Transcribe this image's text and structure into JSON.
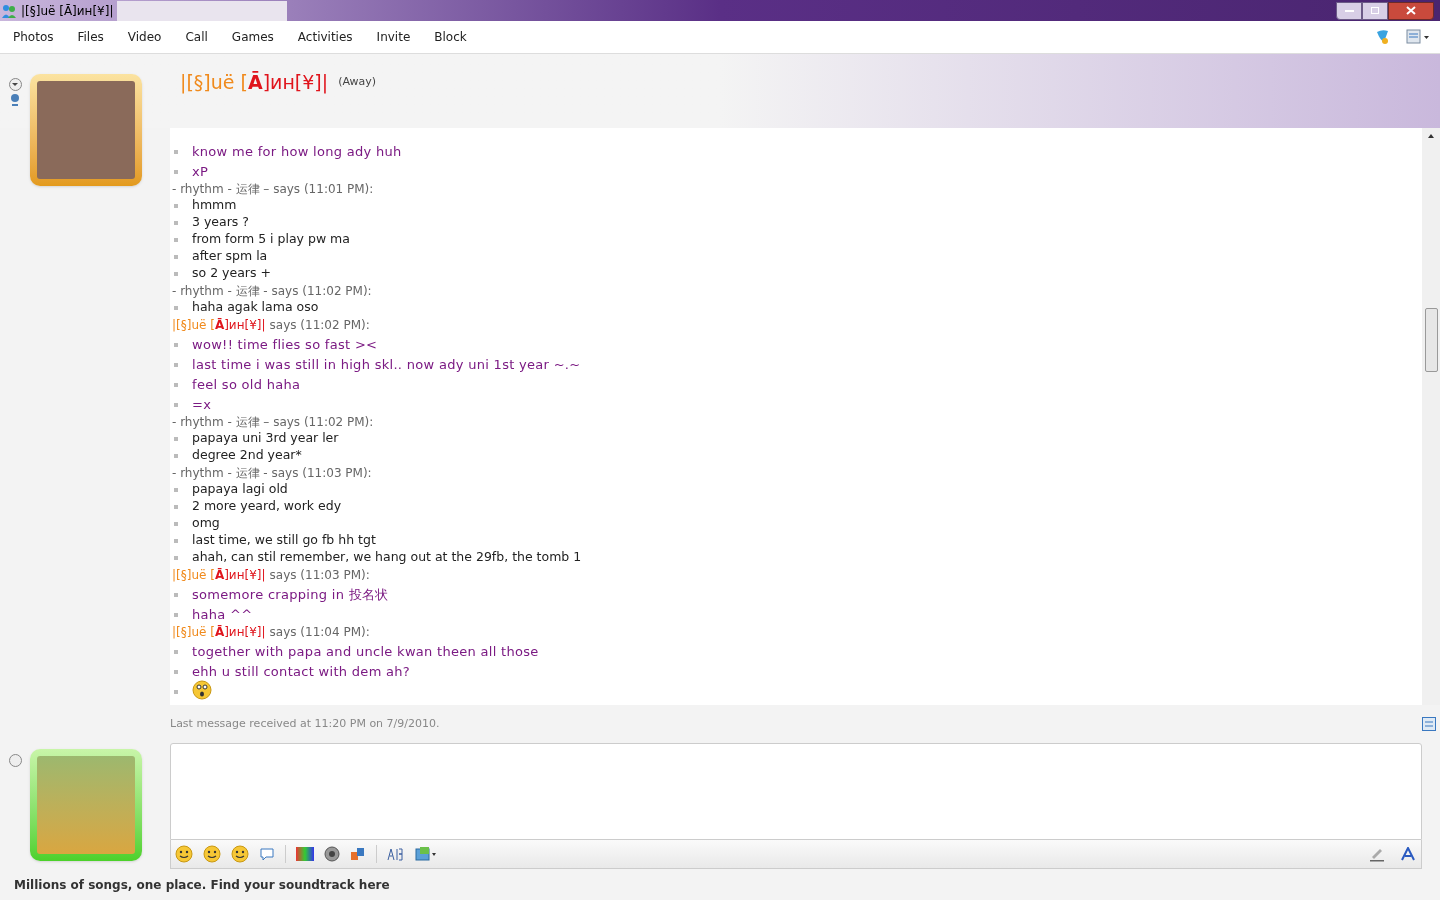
{
  "window": {
    "title": "|[§]uë [Ā]ин[¥]|"
  },
  "menu": [
    "Photos",
    "Files",
    "Video",
    "Call",
    "Games",
    "Activities",
    "Invite",
    "Block"
  ],
  "contact": {
    "name": [
      {
        "text": "|[§]uë [",
        "color": "#f08a1c",
        "bold": false
      },
      {
        "text": "Ā",
        "color": "#e0141c",
        "bold": true
      },
      {
        "text": "]ин[¥]|",
        "color": "#e0141c",
        "bold": false
      }
    ],
    "status": "(Away)"
  },
  "conversation": [
    {
      "kind": "self",
      "lines": [
        {
          "kind": "text",
          "text": "know me for how long ady huh"
        },
        {
          "kind": "text",
          "text": "xP"
        }
      ]
    },
    {
      "kind": "contact",
      "header": "- rhythm - 运律 – says (11:01 PM):",
      "lines": [
        {
          "kind": "text",
          "text": "hmmm"
        },
        {
          "kind": "text",
          "text": "3 years ?"
        },
        {
          "kind": "text",
          "text": "from form 5 i play pw ma"
        },
        {
          "kind": "text",
          "text": "after spm la"
        },
        {
          "kind": "text",
          "text": "so 2 years +"
        }
      ]
    },
    {
      "kind": "contact",
      "header": "- rhythm - 运律 - says (11:02 PM):",
      "lines": [
        {
          "kind": "text",
          "text": "haha agak lama oso"
        }
      ]
    },
    {
      "kind": "self",
      "name": [
        {
          "text": "|[§]uë [",
          "color": "#f08a1c",
          "bold": false
        },
        {
          "text": "Ā",
          "color": "#e0141c",
          "bold": true
        },
        {
          "text": "]ин[¥]|",
          "color": "#e0141c",
          "bold": false
        }
      ],
      "header": "says (11:02 PM):",
      "lines": [
        {
          "kind": "text",
          "text": "wow!! time flies so fast ><"
        },
        {
          "kind": "text",
          "text": "last time i was still in high skl.. now ady uni 1st year ~.~"
        },
        {
          "kind": "text",
          "text": "feel so old haha"
        },
        {
          "kind": "text",
          "text": "=x"
        }
      ]
    },
    {
      "kind": "contact",
      "header": "- rhythm - 运律 – says (11:02 PM):",
      "lines": [
        {
          "kind": "text",
          "text": "papaya uni 3rd year ler"
        },
        {
          "kind": "text",
          "text": "degree 2nd year*"
        }
      ]
    },
    {
      "kind": "contact",
      "header": "- rhythm - 运律 - says (11:03 PM):",
      "lines": [
        {
          "kind": "text",
          "text": "papaya lagi old"
        },
        {
          "kind": "text",
          "text": "2 more yeard, work edy"
        },
        {
          "kind": "text",
          "text": "omg"
        },
        {
          "kind": "text",
          "text": "last time, we still go fb hh tgt"
        },
        {
          "kind": "text",
          "text": "ahah, can stil remember, we hang out at the 29fb, the tomb 1"
        }
      ]
    },
    {
      "kind": "self",
      "name": [
        {
          "text": "|[§]uë [",
          "color": "#f08a1c",
          "bold": false
        },
        {
          "text": "Ā",
          "color": "#e0141c",
          "bold": true
        },
        {
          "text": "]ин[¥]|",
          "color": "#e0141c",
          "bold": false
        }
      ],
      "header": "says (11:03 PM):",
      "lines": [
        {
          "kind": "text",
          "text": "somemore crapping in 投名状"
        },
        {
          "kind": "text",
          "text": "haha ^^"
        }
      ]
    },
    {
      "kind": "self",
      "name": [
        {
          "text": "|[§]uë [",
          "color": "#f08a1c",
          "bold": false
        },
        {
          "text": "Ā",
          "color": "#e0141c",
          "bold": true
        },
        {
          "text": "]ин[¥]|",
          "color": "#e0141c",
          "bold": false
        }
      ],
      "header": "says (11:04 PM):",
      "lines": [
        {
          "kind": "text",
          "text": "together with papa and uncle kwan theen all those"
        },
        {
          "kind": "text",
          "text": "ehh u still contact with dem ah?"
        },
        {
          "kind": "emoticon"
        }
      ]
    }
  ],
  "last_message": "Last message received at 11:20 PM on 7/9/2010.",
  "ad": "Millions of songs, one place. Find your soundtrack here"
}
